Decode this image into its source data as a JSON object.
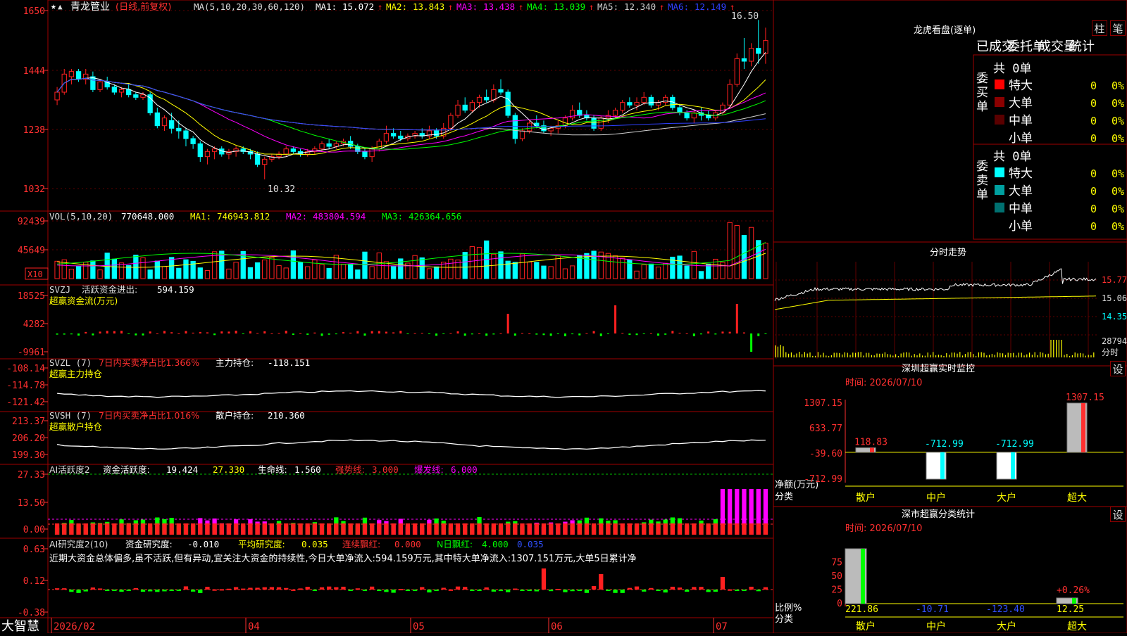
{
  "app": {
    "brand": "大智慧"
  },
  "stock": {
    "name": "青龙管业",
    "mode": "(日线,前复权)"
  },
  "main_panel": {
    "ma_header": "MA(5,10,20,30,60,120)",
    "ma_values": [
      {
        "label": "MA1:",
        "value": "15.072",
        "color": "#ffffff"
      },
      {
        "label": "MA2:",
        "value": "13.843",
        "color": "#ffff00"
      },
      {
        "label": "MA3:",
        "value": "13.438",
        "color": "#ff00ff"
      },
      {
        "label": "MA4:",
        "value": "13.039",
        "color": "#00ff00"
      },
      {
        "label": "MA5:",
        "value": "12.340",
        "color": "#d0d0d0"
      },
      {
        "label": "MA6:",
        "value": "12.149",
        "color": "#3040ff"
      }
    ],
    "y_ticks": [
      "1650",
      "1444",
      "1238",
      "1032"
    ],
    "y_range": [
      9.5,
      17.0
    ],
    "high_label": "16.50",
    "low_label": "10.32"
  },
  "vol_panel": {
    "header": "VOL(5,10,20)",
    "value": "770648.000",
    "ma": [
      {
        "label": "MA1:",
        "value": "746943.812",
        "color": "#ffff00"
      },
      {
        "label": "MA2:",
        "value": "483804.594",
        "color": "#ff00ff"
      },
      {
        "label": "MA3:",
        "value": "426364.656",
        "color": "#00ff00"
      }
    ],
    "y_ticks": [
      "92439",
      "45649"
    ],
    "unit": "X10"
  },
  "svzj_panel": {
    "line1_a": "SVZJ",
    "line1_b": "活跃资金进出:",
    "line1_value": "594.159",
    "line2": "超赢资金流(万元)",
    "y_ticks": [
      "18525",
      "4282",
      "-9961"
    ]
  },
  "svzl_panel": {
    "a": "SVZL (7)",
    "b": "7日内买卖净占比1.366%",
    "c": "主力持仓:",
    "value": "-118.151",
    "line2": "超赢主力持仓",
    "y_ticks": [
      "-108.14",
      "-114.78",
      "-121.42"
    ]
  },
  "svsh_panel": {
    "a": "SVSH (7)",
    "b": "7日内买卖净占比1.016%",
    "c": "散户持仓:",
    "value": "210.360",
    "line2": "超赢散户持仓",
    "y_ticks": [
      "213.37",
      "206.20",
      "199.30"
    ]
  },
  "ai_active_panel": {
    "a": "AI活跃度2",
    "b": "资金活跃度:",
    "v1": "19.424",
    "v2": "27.330",
    "c": "生命线:",
    "v3": "1.560",
    "strong": "强势线:",
    "v4": "3.000",
    "burst": "爆发线:",
    "v5": "6.000",
    "y_ticks": [
      "27.33",
      "13.50",
      "0.00"
    ]
  },
  "ai_research_panel": {
    "a": "AI研究度2(10)",
    "b": "资金研究度:",
    "v1": "-0.010",
    "c": "平均研究度:",
    "v2": "0.035",
    "d": "连续飘红:",
    "v3": "0.000",
    "e": "N日飘红:",
    "v4": "4.000",
    "v5": "0.035",
    "comment": "近期大资金总体偏多,虽不活跃,但有异动,宜关注大资金的持续性,今日大单净流入:594.159万元,其中特大单净流入:1307.151万元,大单5日累计净",
    "y_ticks": [
      "0.63",
      "0.12",
      "-0.38"
    ]
  },
  "x_axis": [
    "2026/02",
    "04",
    "05",
    "06",
    "07"
  ],
  "lhb": {
    "title": "龙虎看盘(逐单)",
    "btn_col": "柱",
    "btn_pen": "笔",
    "tabs": [
      "已成交",
      "委托单",
      "成交量",
      "统计"
    ],
    "buy_side_label": "委买单",
    "sell_side_label": "委卖单",
    "buy_total": "共 0单",
    "sell_total": "共 0单",
    "buy_rows": [
      {
        "label": "特大",
        "count": "0",
        "pct": "0%",
        "color": "#ff0000"
      },
      {
        "label": "大单",
        "count": "0",
        "pct": "0%",
        "color": "#8b0000"
      },
      {
        "label": "中单",
        "count": "0",
        "pct": "0%",
        "color": "#5a0000"
      },
      {
        "label": "小单",
        "count": "0",
        "pct": "0%",
        "color": "#000000"
      }
    ],
    "sell_rows": [
      {
        "label": "特大",
        "count": "0",
        "pct": "0%",
        "color": "#00ffff"
      },
      {
        "label": "大单",
        "count": "0",
        "pct": "0%",
        "color": "#00a0a0"
      },
      {
        "label": "中单",
        "count": "0",
        "pct": "0%",
        "color": "#007070"
      },
      {
        "label": "小单",
        "count": "0",
        "pct": "0%",
        "color": "#000000"
      }
    ]
  },
  "intraday": {
    "title": "分时走势",
    "price_labels": [
      "15.77",
      "15.06",
      "14.35"
    ],
    "vol_label": "28794",
    "vol_unit": "分时"
  },
  "sz_monitor": {
    "title": "深圳超赢实时监控",
    "set_btn": "设",
    "date_label": "时间: 2026/07/10",
    "y_ticks": [
      "1307.15",
      "633.77",
      "-39.60",
      "-712.99"
    ],
    "ylabel": "净额(万元)",
    "xlabel": "分类",
    "categories": [
      "散户",
      "中户",
      "大户",
      "超大"
    ],
    "values": [
      118.83,
      -712.99,
      -712.99,
      1307.15
    ],
    "value_labels": [
      "118.83",
      "-712.99",
      "-712.99",
      "1307.15"
    ]
  },
  "sz_classify": {
    "title": "深市超赢分类统计",
    "set_btn": "设",
    "date_label": "时间: 2026/07/10",
    "y_ticks": [
      "75",
      "50",
      "25",
      "0"
    ],
    "ylabel": "比例%",
    "xlabel": "分类",
    "categories": [
      "散户",
      "中户",
      "大户",
      "超大"
    ],
    "values": [
      221.86,
      -10.71,
      -123.4,
      12.25
    ],
    "value_labels": [
      "221.86",
      "-10.71",
      "-123.40",
      "12.25"
    ],
    "extra_label": "+0.26%"
  },
  "chart_data": [
    {
      "type": "candlestick",
      "title": "青龙管业 (日线,前复权)",
      "ylim": [
        9.5,
        17.0
      ],
      "ohlc": [
        [
          13.4,
          13.9,
          13.2,
          13.7
        ],
        [
          13.7,
          14.6,
          13.6,
          14.4
        ],
        [
          14.3,
          14.6,
          14.0,
          14.5
        ],
        [
          14.5,
          14.6,
          14.1,
          14.2
        ],
        [
          14.2,
          14.6,
          14.0,
          14.4
        ],
        [
          14.3,
          14.5,
          13.7,
          13.8
        ],
        [
          13.8,
          14.2,
          13.7,
          14.1
        ],
        [
          14.1,
          14.3,
          13.8,
          13.9
        ],
        [
          13.9,
          14.0,
          13.6,
          13.7
        ],
        [
          13.7,
          13.9,
          13.5,
          13.8
        ],
        [
          13.8,
          14.0,
          13.5,
          13.6
        ],
        [
          13.6,
          13.7,
          13.4,
          13.5
        ],
        [
          13.5,
          13.7,
          13.4,
          13.6
        ],
        [
          13.6,
          13.7,
          12.8,
          12.9
        ],
        [
          12.9,
          13.1,
          12.3,
          12.4
        ],
        [
          12.4,
          12.8,
          12.2,
          12.7
        ],
        [
          12.6,
          12.9,
          12.1,
          12.3
        ],
        [
          12.3,
          12.6,
          11.9,
          12.2
        ],
        [
          12.2,
          12.3,
          11.6,
          11.9
        ],
        [
          11.9,
          12.0,
          11.5,
          11.7
        ],
        [
          11.7,
          11.8,
          11.0,
          11.2
        ],
        [
          11.2,
          11.5,
          10.9,
          11.4
        ],
        [
          11.4,
          11.6,
          11.1,
          11.5
        ],
        [
          11.5,
          11.6,
          11.2,
          11.3
        ],
        [
          11.3,
          11.5,
          11.1,
          11.4
        ],
        [
          11.4,
          11.6,
          11.2,
          11.5
        ],
        [
          11.5,
          11.6,
          11.3,
          11.4
        ],
        [
          11.4,
          11.5,
          11.1,
          11.3
        ],
        [
          11.3,
          11.4,
          10.8,
          10.9
        ],
        [
          10.9,
          11.2,
          10.32,
          11.1
        ],
        [
          11.1,
          11.3,
          11.0,
          11.2
        ],
        [
          11.2,
          11.4,
          11.1,
          11.3
        ],
        [
          11.3,
          11.6,
          11.2,
          11.5
        ],
        [
          11.5,
          11.6,
          11.3,
          11.4
        ],
        [
          11.4,
          11.5,
          11.2,
          11.3
        ],
        [
          11.3,
          11.5,
          11.2,
          11.4
        ],
        [
          11.4,
          11.6,
          11.3,
          11.5
        ],
        [
          11.5,
          11.8,
          11.4,
          11.7
        ],
        [
          11.7,
          11.9,
          11.5,
          11.6
        ],
        [
          11.6,
          11.8,
          11.5,
          11.7
        ],
        [
          11.7,
          11.9,
          11.6,
          11.8
        ],
        [
          11.8,
          12.0,
          11.5,
          11.6
        ],
        [
          11.6,
          11.7,
          11.3,
          11.4
        ],
        [
          11.4,
          11.5,
          11.1,
          11.2
        ],
        [
          11.2,
          11.6,
          11.0,
          11.5
        ],
        [
          11.5,
          11.9,
          11.4,
          11.8
        ],
        [
          11.8,
          12.4,
          11.7,
          12.1
        ],
        [
          12.1,
          12.3,
          11.9,
          12.0
        ],
        [
          12.0,
          12.2,
          11.8,
          11.9
        ],
        [
          11.9,
          12.1,
          11.8,
          12.0
        ],
        [
          12.0,
          12.2,
          11.9,
          12.1
        ],
        [
          12.1,
          12.3,
          11.9,
          12.0
        ],
        [
          12.0,
          12.4,
          11.9,
          12.2
        ],
        [
          12.2,
          12.3,
          11.9,
          12.0
        ],
        [
          12.0,
          12.5,
          11.9,
          12.3
        ],
        [
          12.3,
          12.9,
          12.2,
          12.8
        ],
        [
          12.8,
          13.4,
          12.7,
          13.2
        ],
        [
          13.2,
          13.5,
          12.9,
          13.0
        ],
        [
          13.0,
          13.4,
          12.9,
          13.3
        ],
        [
          13.3,
          13.6,
          13.1,
          13.5
        ],
        [
          13.5,
          13.8,
          13.3,
          13.4
        ],
        [
          13.4,
          14.0,
          13.3,
          13.8
        ],
        [
          13.8,
          14.2,
          13.6,
          13.7
        ],
        [
          13.7,
          13.8,
          12.7,
          12.8
        ],
        [
          12.8,
          12.9,
          11.7,
          11.9
        ],
        [
          11.9,
          12.3,
          11.8,
          12.2
        ],
        [
          12.2,
          12.6,
          12.1,
          12.5
        ],
        [
          12.5,
          12.8,
          12.3,
          12.4
        ],
        [
          12.4,
          12.6,
          12.1,
          12.2
        ],
        [
          12.2,
          12.4,
          12.0,
          12.3
        ],
        [
          12.3,
          12.6,
          12.1,
          12.4
        ],
        [
          12.4,
          12.8,
          12.3,
          12.7
        ],
        [
          12.7,
          13.2,
          12.6,
          13.0
        ],
        [
          13.0,
          13.3,
          12.7,
          12.8
        ],
        [
          12.8,
          13.0,
          12.6,
          12.7
        ],
        [
          12.7,
          12.8,
          12.2,
          12.3
        ],
        [
          12.3,
          12.8,
          12.2,
          12.7
        ],
        [
          12.7,
          13.0,
          12.5,
          12.8
        ],
        [
          12.8,
          13.1,
          12.7,
          13.0
        ],
        [
          13.0,
          13.4,
          12.9,
          13.3
        ],
        [
          13.3,
          13.5,
          13.1,
          13.2
        ],
        [
          13.2,
          13.5,
          13.0,
          13.3
        ],
        [
          13.3,
          13.7,
          13.2,
          13.5
        ],
        [
          13.5,
          13.6,
          13.1,
          13.2
        ],
        [
          13.2,
          13.4,
          13.0,
          13.3
        ],
        [
          13.3,
          13.6,
          13.2,
          13.5
        ],
        [
          13.5,
          13.6,
          13.0,
          13.1
        ],
        [
          13.1,
          13.2,
          12.8,
          12.9
        ],
        [
          12.9,
          13.0,
          12.6,
          12.7
        ],
        [
          12.7,
          13.0,
          12.5,
          12.9
        ],
        [
          12.9,
          13.1,
          12.6,
          12.8
        ],
        [
          12.8,
          13.0,
          12.6,
          12.7
        ],
        [
          12.7,
          13.0,
          12.6,
          12.9
        ],
        [
          12.9,
          13.3,
          12.8,
          13.2
        ],
        [
          13.2,
          14.2,
          13.1,
          14.0
        ],
        [
          14.0,
          15.2,
          13.9,
          15.0
        ],
        [
          15.0,
          15.8,
          14.6,
          14.9
        ],
        [
          14.9,
          15.6,
          14.7,
          15.4
        ],
        [
          15.4,
          16.5,
          14.8,
          15.2
        ],
        [
          15.2,
          16.2,
          14.8,
          15.7
        ]
      ]
    },
    {
      "type": "bar",
      "title": "深圳超赢实时监控",
      "xlabel": "分类",
      "ylabel": "净额(万元)",
      "categories": [
        "散户",
        "中户",
        "大户",
        "超大"
      ],
      "values": [
        118.83,
        -712.99,
        -712.99,
        1307.15
      ],
      "ylim": [
        -712.99,
        1307.15
      ]
    },
    {
      "type": "bar",
      "title": "深市超赢分类统计",
      "xlabel": "分类",
      "ylabel": "比例%",
      "categories": [
        "散户",
        "中户",
        "大户",
        "超大"
      ],
      "values": [
        221.86,
        -10.71,
        -123.4,
        12.25
      ],
      "ylim": [
        0,
        75
      ]
    }
  ]
}
